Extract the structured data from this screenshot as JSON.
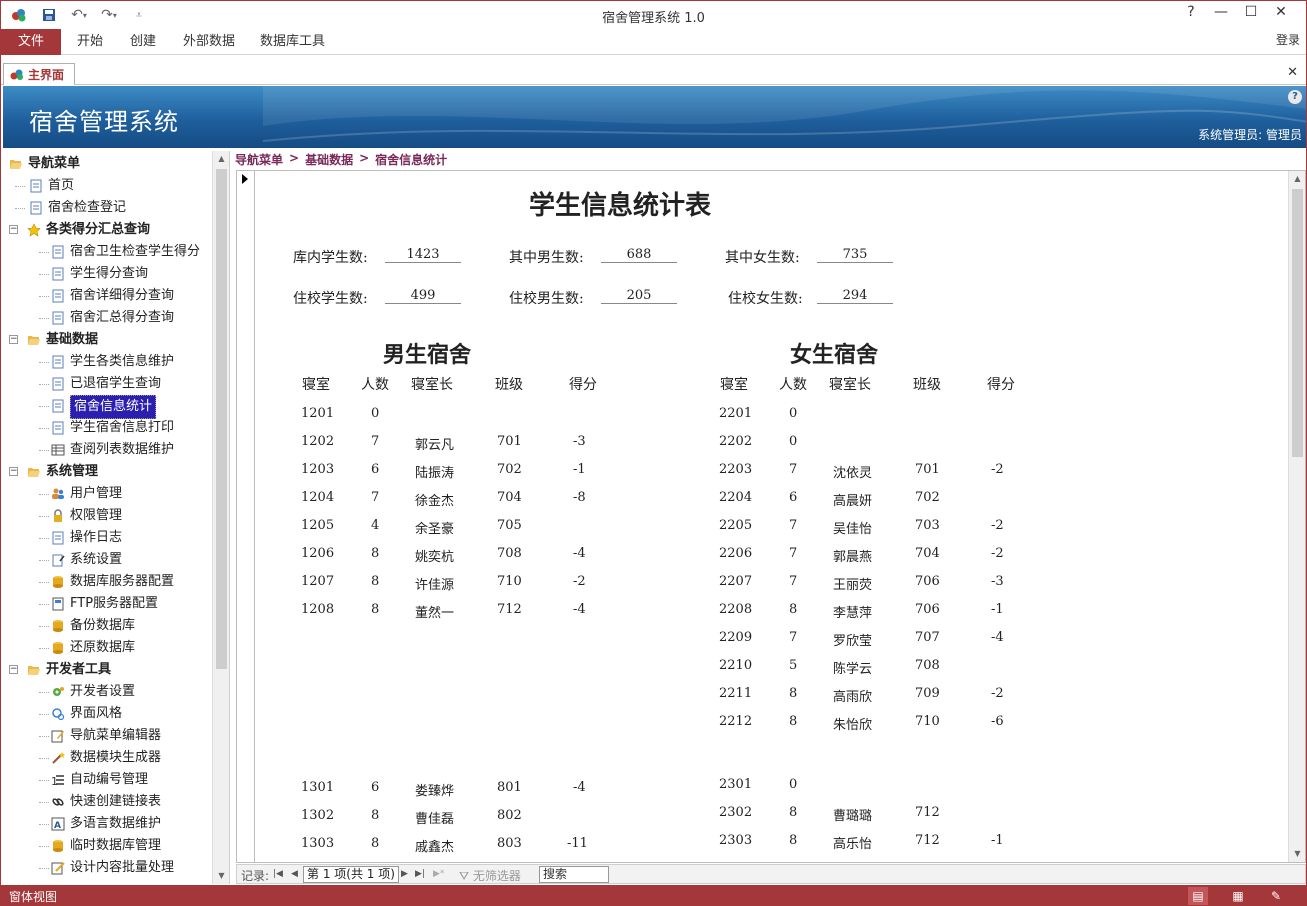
{
  "window": {
    "title": "宿舍管理系统 1.0",
    "help": "?",
    "minimize": "—",
    "maximize": "☐",
    "close": "✕"
  },
  "ribbon": {
    "file": "文件",
    "tabs": [
      "开始",
      "创建",
      "外部数据",
      "数据库工具"
    ],
    "login": "登录"
  },
  "doc_tab": {
    "label": "主界面",
    "close": "✕"
  },
  "banner": {
    "title": "宿舍管理系统",
    "user": "系统管理员: 管理员",
    "help": "?"
  },
  "nav": {
    "rows": [
      {
        "label": "导航菜单",
        "level": 0,
        "icon": "folder-open-icon",
        "group": true
      },
      {
        "label": "首页",
        "level": 1,
        "icon": "document-icon"
      },
      {
        "label": "宿舍检查登记",
        "level": 1,
        "icon": "document-icon"
      },
      {
        "label": "各类得分汇总查询",
        "level": 1,
        "icon": "star-icon",
        "group": true,
        "expander": "−"
      },
      {
        "label": "宿舍卫生检查学生得分",
        "level": 2,
        "icon": "document-icon"
      },
      {
        "label": "学生得分查询",
        "level": 2,
        "icon": "document-icon"
      },
      {
        "label": "宿舍详细得分查询",
        "level": 2,
        "icon": "document-icon"
      },
      {
        "label": "宿舍汇总得分查询",
        "level": 2,
        "icon": "document-icon"
      },
      {
        "label": "基础数据",
        "level": 1,
        "icon": "folder-open-icon",
        "group": true,
        "expander": "−"
      },
      {
        "label": "学生各类信息维护",
        "level": 2,
        "icon": "document-icon"
      },
      {
        "label": "已退宿学生查询",
        "level": 2,
        "icon": "document-icon"
      },
      {
        "label": "宿舍信息统计",
        "level": 2,
        "icon": "document-icon",
        "selected": true
      },
      {
        "label": "学生宿舍信息打印",
        "level": 2,
        "icon": "document-icon"
      },
      {
        "label": "查阅列表数据维护",
        "level": 2,
        "icon": "table-icon"
      },
      {
        "label": "系统管理",
        "level": 1,
        "icon": "folder-open-icon",
        "group": true,
        "expander": "−"
      },
      {
        "label": "用户管理",
        "level": 2,
        "icon": "users-icon"
      },
      {
        "label": "权限管理",
        "level": 2,
        "icon": "lock-icon"
      },
      {
        "label": "操作日志",
        "level": 2,
        "icon": "document-icon"
      },
      {
        "label": "系统设置",
        "level": 2,
        "icon": "settings-icon"
      },
      {
        "label": "数据库服务器配置",
        "level": 2,
        "icon": "database-icon"
      },
      {
        "label": "FTP服务器配置",
        "level": 2,
        "icon": "ftp-icon"
      },
      {
        "label": "备份数据库",
        "level": 2,
        "icon": "database-icon"
      },
      {
        "label": "还原数据库",
        "level": 2,
        "icon": "database-icon"
      },
      {
        "label": "开发者工具",
        "level": 1,
        "icon": "folder-open-icon",
        "group": true,
        "expander": "−"
      },
      {
        "label": "开发者设置",
        "level": 2,
        "icon": "gear-icon"
      },
      {
        "label": "界面风格",
        "level": 2,
        "icon": "palette-icon"
      },
      {
        "label": "导航菜单编辑器",
        "level": 2,
        "icon": "edit-icon"
      },
      {
        "label": "数据模块生成器",
        "level": 2,
        "icon": "wand-icon"
      },
      {
        "label": "自动编号管理",
        "level": 2,
        "icon": "list-icon"
      },
      {
        "label": "快速创建链接表",
        "level": 2,
        "icon": "link-icon"
      },
      {
        "label": "多语言数据维护",
        "level": 2,
        "icon": "language-icon"
      },
      {
        "label": "临时数据库管理",
        "level": 2,
        "icon": "database-icon"
      },
      {
        "label": "设计内容批量处理",
        "level": 2,
        "icon": "batch-icon"
      }
    ]
  },
  "breadcrumb": [
    "导航菜单",
    "基础数据",
    "宿舍信息统计"
  ],
  "breadcrumb_sep": ">",
  "report": {
    "title": "学生信息统计表",
    "stats": [
      {
        "label": "库内学生数:",
        "value": "1423"
      },
      {
        "label": "其中男生数:",
        "value": "688"
      },
      {
        "label": "其中女生数:",
        "value": "735"
      },
      {
        "label": "住校学生数:",
        "value": "499"
      },
      {
        "label": "住校男生数:",
        "value": "205"
      },
      {
        "label": "住校女生数:",
        "value": "294"
      }
    ],
    "male_title": "男生宿舍",
    "female_title": "女生宿舍",
    "columns": [
      "寝室",
      "人数",
      "寝室长",
      "班级",
      "得分"
    ],
    "male_rows": [
      [
        "1201",
        "0",
        "",
        "",
        ""
      ],
      [
        "1202",
        "7",
        "郭云凡",
        "701",
        "-3"
      ],
      [
        "1203",
        "6",
        "陆振涛",
        "702",
        "-1"
      ],
      [
        "1204",
        "7",
        "徐金杰",
        "704",
        "-8"
      ],
      [
        "1205",
        "4",
        "余圣豪",
        "705",
        ""
      ],
      [
        "1206",
        "8",
        "姚奕杭",
        "708",
        "-4"
      ],
      [
        "1207",
        "8",
        "许佳源",
        "710",
        "-2"
      ],
      [
        "1208",
        "8",
        "董然一",
        "712",
        "-4"
      ],
      [
        "1301",
        "6",
        "娄臻烨",
        "801",
        "-4"
      ],
      [
        "1302",
        "8",
        "曹佳磊",
        "802",
        ""
      ],
      [
        "1303",
        "8",
        "戚鑫杰",
        "803",
        "-11"
      ]
    ],
    "female_rows": [
      [
        "2201",
        "0",
        "",
        "",
        ""
      ],
      [
        "2202",
        "0",
        "",
        "",
        ""
      ],
      [
        "2203",
        "7",
        "沈依灵",
        "701",
        "-2"
      ],
      [
        "2204",
        "6",
        "高晨妍",
        "702",
        ""
      ],
      [
        "2205",
        "7",
        "吴佳怡",
        "703",
        "-2"
      ],
      [
        "2206",
        "7",
        "郭晨燕",
        "704",
        "-2"
      ],
      [
        "2207",
        "7",
        "王丽荧",
        "706",
        "-3"
      ],
      [
        "2208",
        "8",
        "李慧萍",
        "706",
        "-1"
      ],
      [
        "2209",
        "7",
        "罗欣莹",
        "707",
        "-4"
      ],
      [
        "2210",
        "5",
        "陈学云",
        "708",
        ""
      ],
      [
        "2211",
        "8",
        "高雨欣",
        "709",
        "-2"
      ],
      [
        "2212",
        "8",
        "朱怡欣",
        "710",
        "-6"
      ],
      [
        "2301",
        "0",
        "",
        "",
        ""
      ],
      [
        "2302",
        "8",
        "曹璐璐",
        "712",
        ""
      ],
      [
        "2303",
        "8",
        "高乐怡",
        "712",
        "-1"
      ]
    ]
  },
  "recnav": {
    "label": "记录:",
    "first": "|◀",
    "prev": "◀",
    "position": "第 1 项(共 1 项)",
    "next": "▶",
    "last": "▶|",
    "new": "▶*",
    "filter": "无筛选器",
    "search": "搜索"
  },
  "statusbar": {
    "text": "窗体视图"
  },
  "colors": {
    "accent": "#a4373a",
    "banner": "#1f5f9d",
    "selected": "#2b1fb0",
    "breadcrumb": "#7a2a5a"
  }
}
